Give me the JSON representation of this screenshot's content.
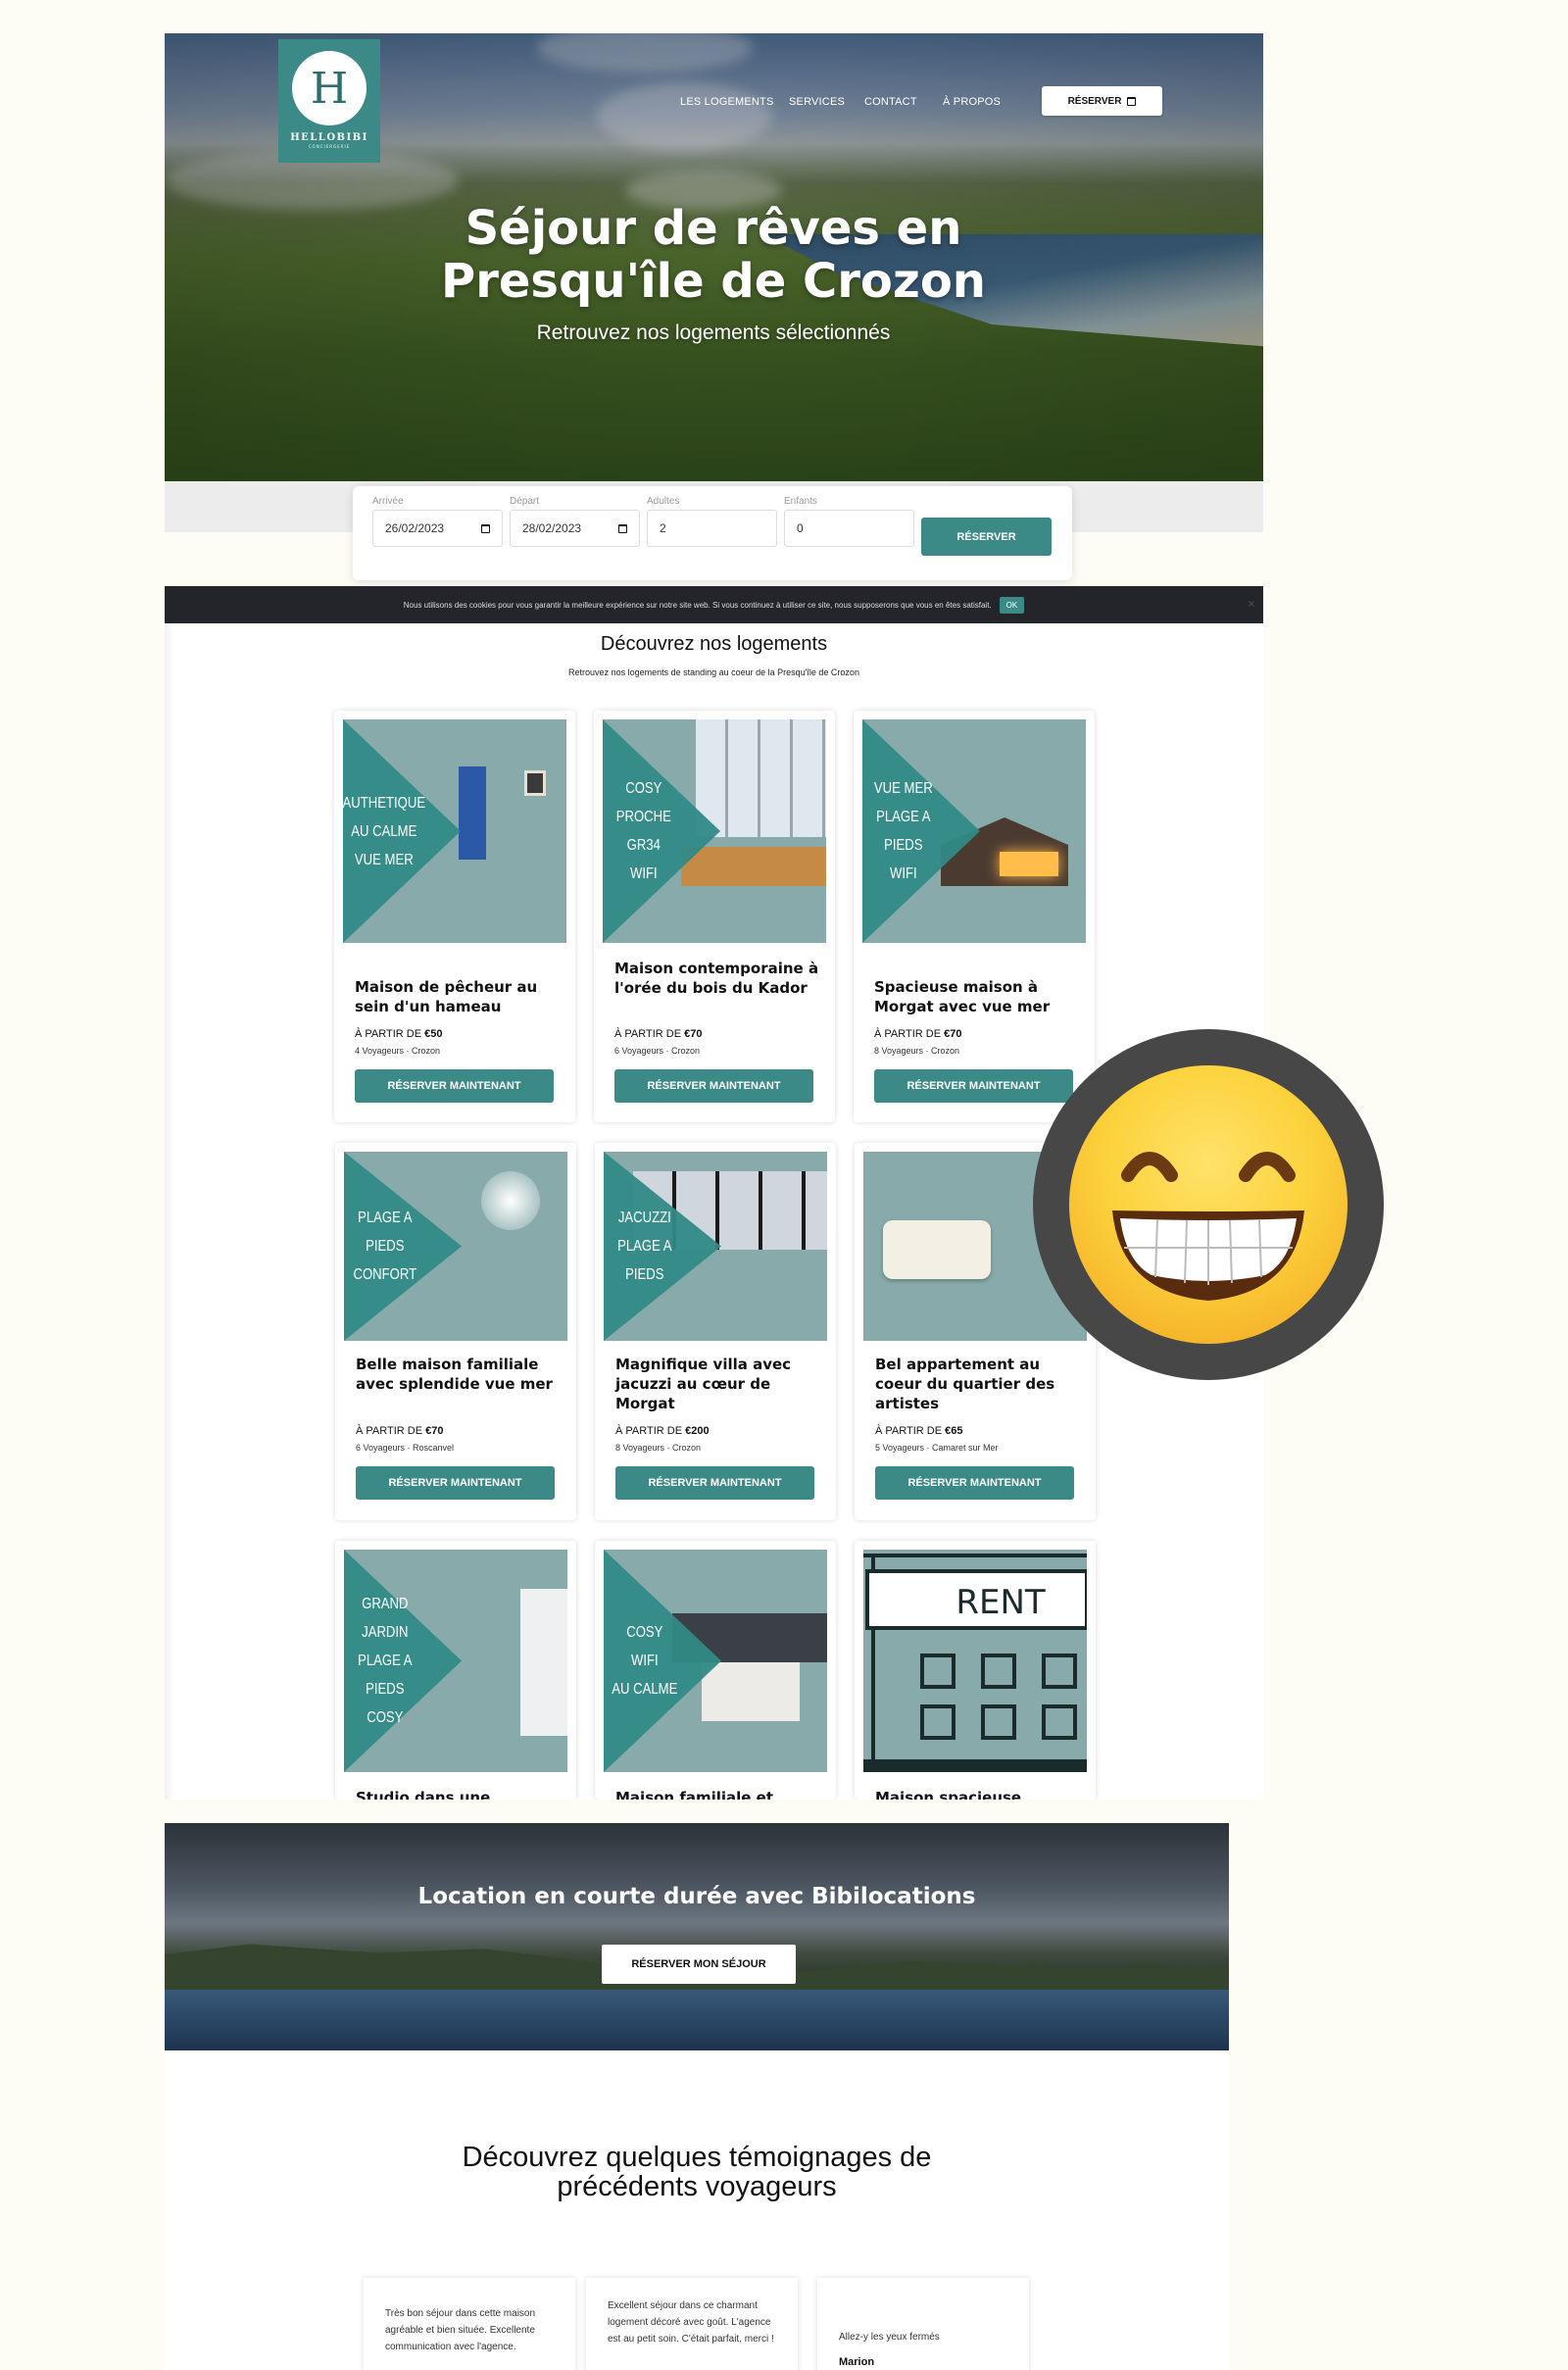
{
  "brand": {
    "initial": "H",
    "name": "HELLOBIBI",
    "tagline": "CONCIERGERIE"
  },
  "nav": {
    "items": [
      "LES LOGEMENTS",
      "SERVICES",
      "CONTACT",
      "À PROPOS"
    ],
    "cta": "RÉSERVER"
  },
  "hero": {
    "title_line1": "Séjour de rêves en",
    "title_line2": "Presqu'île de Crozon",
    "subtitle": "Retrouvez nos logements sélectionnés"
  },
  "booking": {
    "arrival_label": "Arrivée",
    "arrival_value": "26/02/2023",
    "departure_label": "Départ",
    "departure_value": "28/02/2023",
    "adults_label": "Adultes",
    "adults_value": "2",
    "children_label": "Enfants",
    "children_value": "0",
    "submit": "RÉSERVER"
  },
  "cookie": {
    "text": "Nous utilisons des cookies pour vous garantir la meilleure expérience sur notre site web. Si vous continuez à utiliser ce site, nous supposerons que vous en êtes satisfait.",
    "ok": "OK",
    "close": "×"
  },
  "listings": {
    "title": "Découvrez nos logements",
    "subtitle": "Retrouvez nos logements de standing au coeur de la Presqu'île de Crozon",
    "cta": "RÉSERVER MAINTENANT",
    "price_prefix": "À PARTIR DE",
    "items": [
      {
        "tags": [
          "AUTHETIQUE",
          "AU CALME",
          "VUE MER"
        ],
        "name": "Maison de pêcheur au sein d'un hameau",
        "price": "€50",
        "meta": "4 Voyageurs · Crozon"
      },
      {
        "tags": [
          "COSY",
          "PROCHE GR34",
          "WIFI"
        ],
        "name": "Maison contemporaine à l'orée du bois du Kador",
        "price": "€70",
        "meta": "6 Voyageurs · Crozon"
      },
      {
        "tags": [
          "VUE MER",
          "PLAGE A PIEDS",
          "WIFI"
        ],
        "name": "Spacieuse maison à Morgat avec vue mer",
        "price": "€70",
        "meta": "8 Voyageurs · Crozon"
      },
      {
        "tags": [
          "PLAGE A PIEDS",
          "CONFORT"
        ],
        "name": "Belle maison familiale avec splendide vue mer",
        "price": "€70",
        "meta": "6 Voyageurs · Roscanvel"
      },
      {
        "tags": [
          "JACUZZI",
          "PLAGE A PIEDS"
        ],
        "name": "Magnifique villa avec jacuzzi au cœur de Morgat",
        "price": "€200",
        "meta": "8 Voyageurs · Crozon"
      },
      {
        "tags": [],
        "name": "Bel appartement au coeur du quartier des artistes",
        "price": "€65",
        "meta": "5 Voyageurs · Camaret sur Mer"
      },
      {
        "tags": [
          "GRAND JARDIN",
          "PLAGE A PIEDS",
          "COSY"
        ],
        "name": "Studio dans une",
        "price": "",
        "meta": ""
      },
      {
        "tags": [
          "COSY",
          "WIFI",
          "AU CALME"
        ],
        "name": "Maison familiale et",
        "price": "",
        "meta": ""
      },
      {
        "tags": [],
        "name": "Maison spacieuse",
        "price": "",
        "meta": "",
        "placeholder_text": "RENT"
      }
    ]
  },
  "banner": {
    "title": "Location en courte durée avec Bibilocations",
    "cta": "RÉSERVER MON SÉJOUR"
  },
  "testimonials": {
    "title_line1": "Découvrez quelques témoignages de",
    "title_line2": "précédents voyageurs",
    "items": [
      {
        "text": "Très bon séjour dans cette maison agréable et bien située. Excellente communication avec l'agence.",
        "author": ""
      },
      {
        "text": "Excellent séjour dans ce charmant logement décoré avec goût. L'agence est au petit soin. C'était parfait, merci !",
        "author": ""
      },
      {
        "text": "Allez-y les yeux fermés",
        "author": "Marion"
      }
    ]
  },
  "colors": {
    "accent": "#3c8a87",
    "cookie_bg": "#23252b",
    "page_bg": "#fdfdf6"
  }
}
